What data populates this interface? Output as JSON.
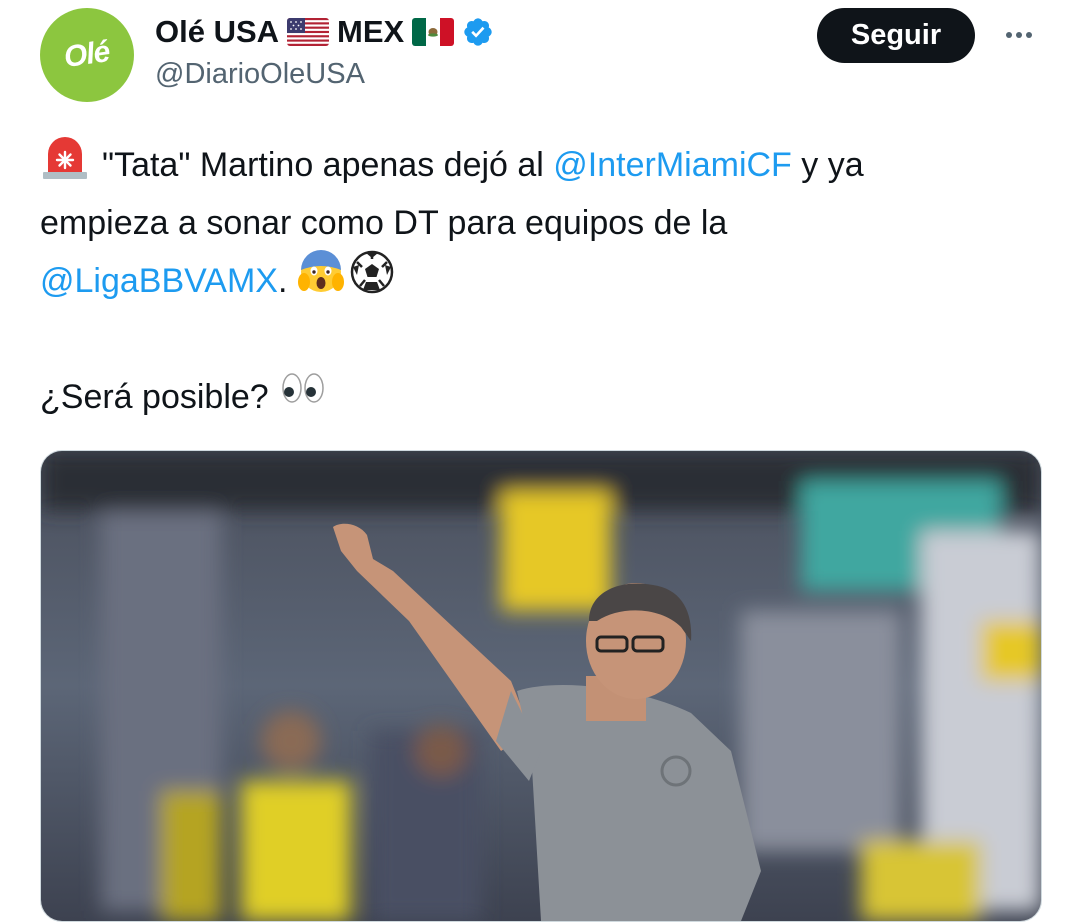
{
  "account": {
    "avatar_text": "Olé",
    "display_name_part1": "Olé USA",
    "display_name_part2": "MEX",
    "handle": "@DiarioOleUSA",
    "verified_color": "#1d9bf0",
    "avatar_color": "#8cc63f"
  },
  "actions": {
    "follow_label": "Seguir"
  },
  "tweet": {
    "line1_pre": "\"Tata\" Martino apenas dejó al ",
    "line1_mention": "@InterMiamiCF",
    "line1_post": " y ya",
    "line2": "empieza a sonar como DT para equipos de la",
    "line3_mention": "@LigaBBVAMX",
    "line3_post": ". ",
    "line5": "¿Será posible? "
  },
  "icons": {
    "siren": "rotating-light-emoji",
    "scream": "screaming-face-emoji",
    "ball": "soccer-ball-emoji",
    "eyes": "eyes-emoji",
    "more": "more-options-icon"
  }
}
